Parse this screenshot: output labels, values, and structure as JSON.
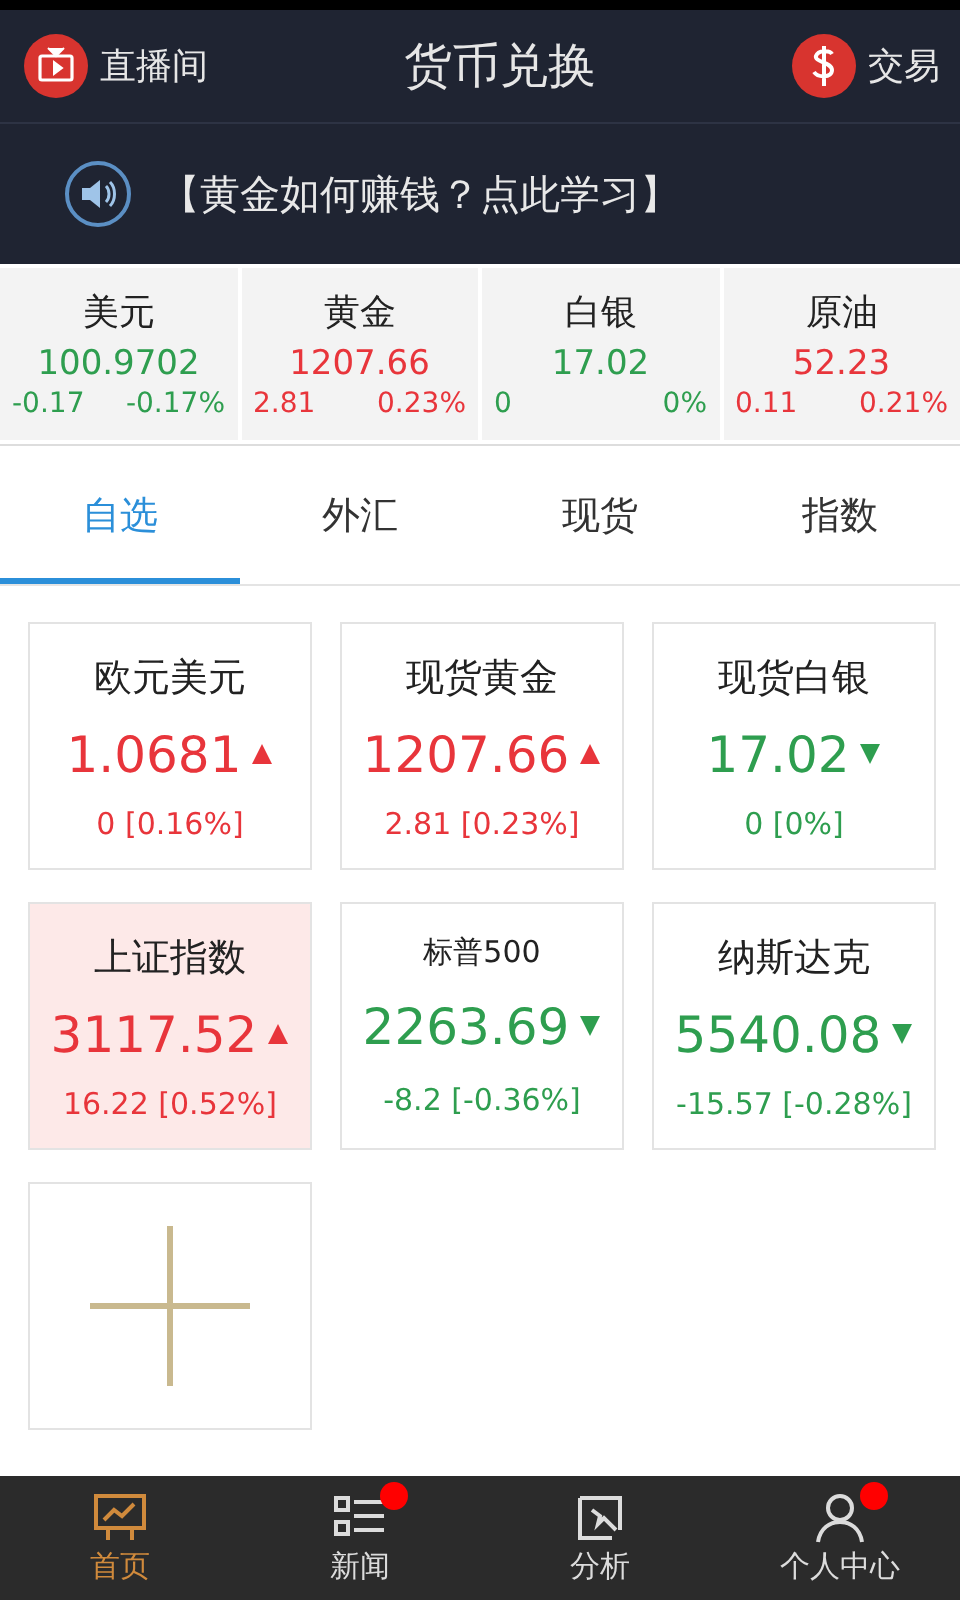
{
  "header": {
    "left_label": "直播间",
    "title": "货币兑换",
    "right_label": "交易"
  },
  "banner": {
    "text": "【黄金如何赚钱？点此学习】"
  },
  "quotes": [
    {
      "name": "美元",
      "price": "100.9702",
      "change": "-0.17",
      "percent": "-0.17%",
      "color": "#2e9e4f"
    },
    {
      "name": "黄金",
      "price": "1207.66",
      "change": "2.81",
      "percent": "0.23%",
      "color": "#e8353b"
    },
    {
      "name": "白银",
      "price": "17.02",
      "change": "0",
      "percent": "0%",
      "color": "#2e9e4f"
    },
    {
      "name": "原油",
      "price": "52.23",
      "change": "0.11",
      "percent": "0.21%",
      "color": "#e8353b"
    }
  ],
  "tabs": [
    {
      "label": "自选",
      "selected": true
    },
    {
      "label": "外汇",
      "selected": false
    },
    {
      "label": "现货",
      "selected": false
    },
    {
      "label": "指数",
      "selected": false
    }
  ],
  "cards": [
    {
      "name": "欧元美元",
      "price": "1.0681",
      "change": "0 [0.16%]",
      "kind": "rise",
      "color": "#e8353b",
      "highlighted": false,
      "small_title": false
    },
    {
      "name": "现货黄金",
      "price": "1207.66",
      "change": "2.81 [0.23%]",
      "kind": "rise",
      "color": "#e8353b",
      "highlighted": false,
      "small_title": false
    },
    {
      "name": "现货白银",
      "price": "17.02",
      "change": "0 [0%]",
      "kind": "fall",
      "color": "#2e9e4f",
      "highlighted": false,
      "small_title": false
    },
    {
      "name": "上证指数",
      "price": "3117.52",
      "change": "16.22 [0.52%]",
      "kind": "rise",
      "color": "#e8353b",
      "highlighted": true,
      "small_title": false
    },
    {
      "name": "标普500",
      "price": "2263.69",
      "change": "-8.2 [-0.36%]",
      "kind": "fall",
      "color": "#2e9e4f",
      "highlighted": false,
      "small_title": true
    },
    {
      "name": "纳斯达克",
      "price": "5540.08",
      "change": "-15.57 [-0.28%]",
      "kind": "fall",
      "color": "#2e9e4f",
      "highlighted": false,
      "small_title": false
    }
  ],
  "nav": [
    {
      "label": "首页",
      "kind": "chart",
      "selected": true,
      "badge": false
    },
    {
      "label": "新闻",
      "kind": "list",
      "selected": false,
      "badge": true
    },
    {
      "label": "分析",
      "kind": "analysis",
      "selected": false,
      "badge": false
    },
    {
      "label": "个人中心",
      "kind": "person",
      "selected": false,
      "badge": true
    }
  ]
}
